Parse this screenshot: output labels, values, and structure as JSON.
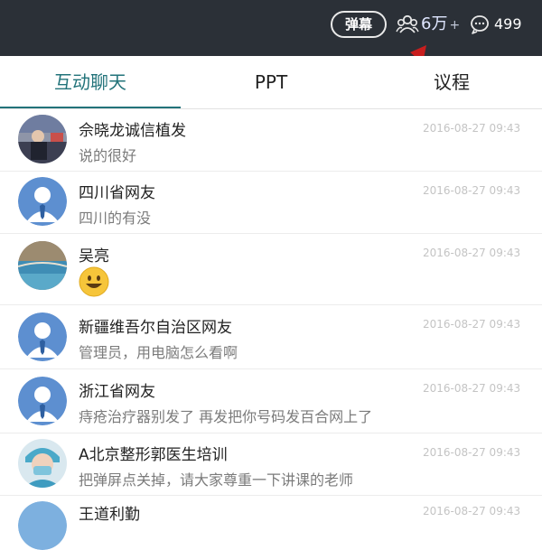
{
  "header": {
    "danmu_label": "弹幕",
    "viewer_count": "6万",
    "viewer_plus": "+",
    "message_count": "499",
    "icons": [
      "people-icon",
      "chat-bubble-icon",
      "red-arrow-icon"
    ]
  },
  "tabs": [
    {
      "label": "互动聊天",
      "active": true
    },
    {
      "label": "PPT",
      "active": false
    },
    {
      "label": "议程",
      "active": false
    }
  ],
  "messages": [
    {
      "name": "佘晓龙诚信植发",
      "text": "说的很好",
      "time": "2016-08-27 09:43",
      "avatar": "photo-avatar"
    },
    {
      "name": "四川省网友",
      "text": "四川的有没",
      "time": "2016-08-27 09:43",
      "avatar": "default-avatar"
    },
    {
      "name": "吴亮",
      "text": "",
      "time": "2016-08-27 09:43",
      "avatar": "photo-avatar",
      "emoji": "smiley-emoji"
    },
    {
      "name": "新疆维吾尔自治区网友",
      "text": "管理员，用电脑怎么看啊",
      "time": "2016-08-27 09:43",
      "avatar": "default-avatar"
    },
    {
      "name": "浙江省网友",
      "text": "痔疮治疗器别发了 再发把你号码发百合网上了",
      "time": "2016-08-27 09:43",
      "avatar": "default-avatar"
    },
    {
      "name": "A北京整形郭医生培训",
      "text": "把弹屏点关掉，请大家尊重一下讲课的老师",
      "time": "2016-08-27 09:43",
      "avatar": "photo-avatar"
    },
    {
      "name": "王道利勤",
      "text": "",
      "time": "2016-08-27 09:43",
      "avatar": "default-avatar"
    }
  ],
  "colors": {
    "header_bg": "#2b3037",
    "accent": "#22737a",
    "arrow": "#c81e1e",
    "avatar_blue": "#5d8fd0"
  }
}
